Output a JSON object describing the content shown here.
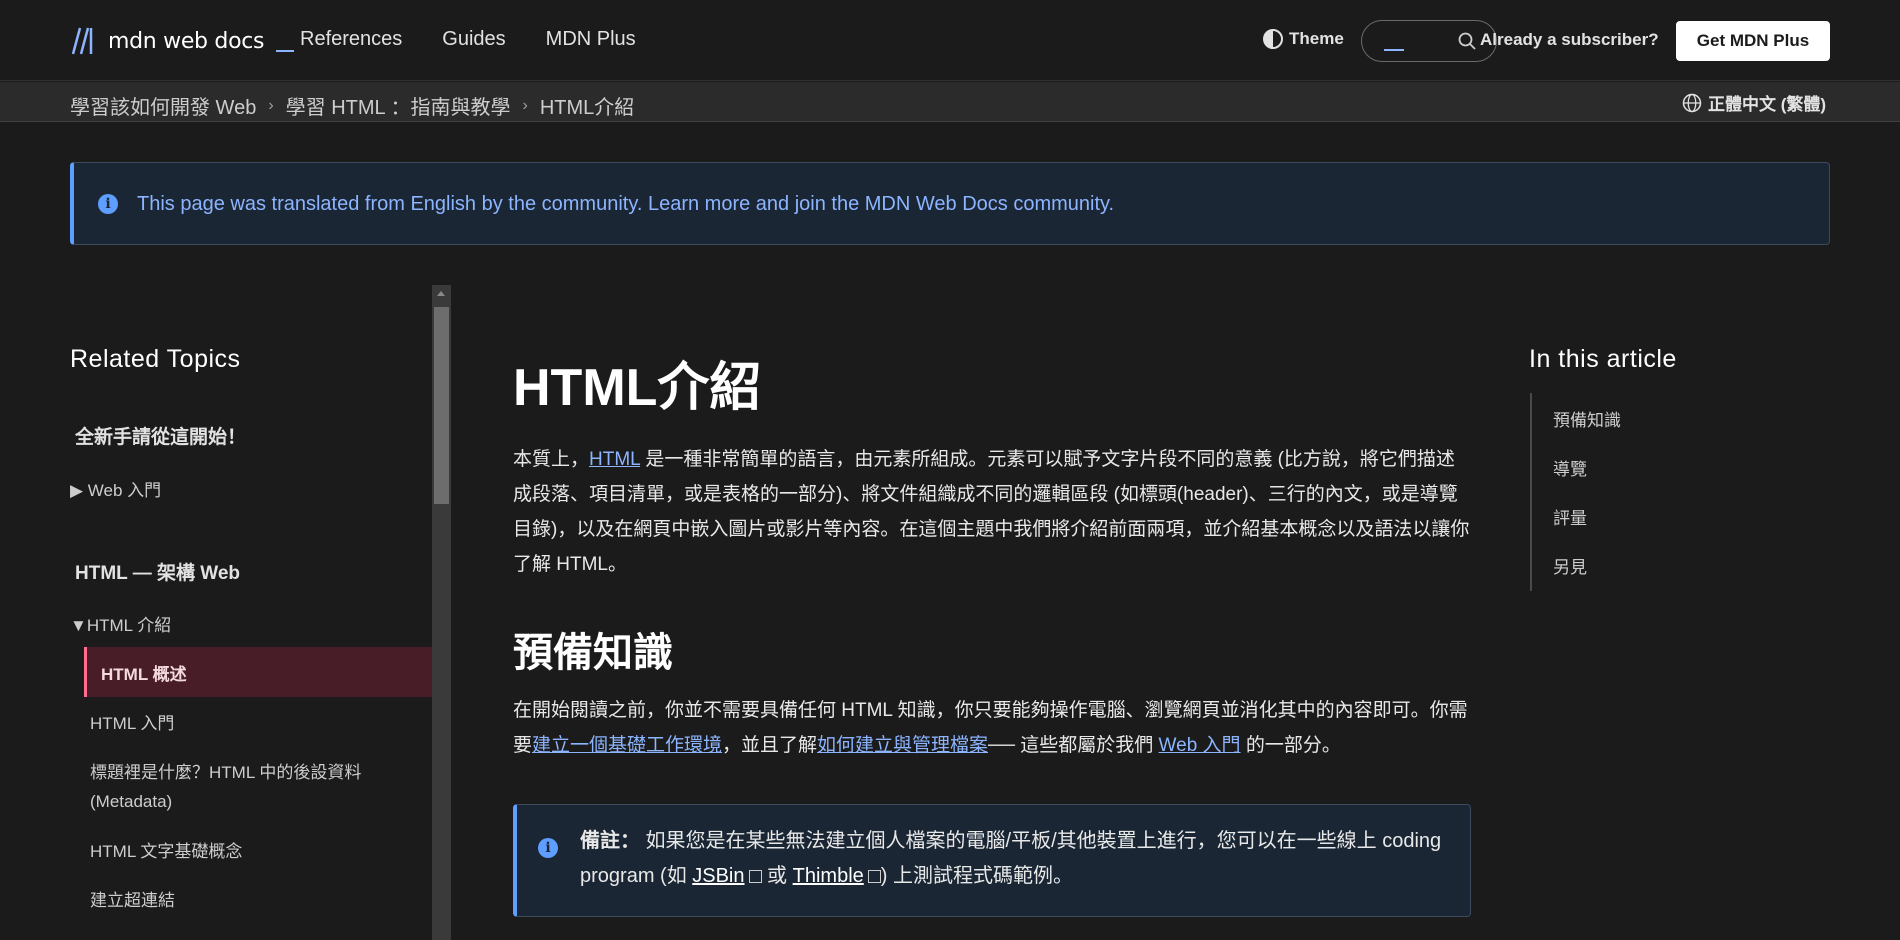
{
  "header": {
    "logo_text": "mdn web docs",
    "nav": [
      "References",
      "Guides",
      "MDN Plus"
    ],
    "theme_label": "Theme",
    "subscriber_text": "Already a subscriber?",
    "get_plus_label": "Get MDN Plus"
  },
  "breadcrumb": {
    "items": [
      "學習該如何開發 Web",
      "學習 HTML ：指南與教學",
      "HTML介紹"
    ],
    "language": "正體中文 (繁體)"
  },
  "notice": {
    "text": "This page was translated from English by the community. Learn more and join the MDN Web Docs community."
  },
  "sidebar": {
    "title": "Related Topics",
    "section1_heading": "全新手請從這開始！",
    "section1_toggle": "▶ Web 入門",
    "section2_heading": "HTML — 架構 Web",
    "section2_toggle": "▼HTML 介紹",
    "active_item": "HTML 概述",
    "items": [
      "HTML 入門",
      "標題裡是什麼？HTML 中的後設資料 (Metadata)",
      "HTML 文字基礎概念",
      "建立超連結"
    ]
  },
  "main": {
    "title": "HTML介紹",
    "intro_pre": "本質上，",
    "intro_link": "HTML",
    "intro_post": " 是一種非常簡單的語言，由元素所組成。元素可以賦予文字片段不同的意義 (比方說，將它們描述成段落、項目清單，或是表格的一部分)、將文件組織成不同的邏輯區段 (如標頭(header)、三行的內文，或是導覽目錄)，以及在網頁中嵌入圖片或影片等內容。在這個主題中我們將介紹前面兩項，並介紹基本概念以及語法以讓你了解 HTML。",
    "section_heading": "預備知識",
    "pre_text1": "在開始閱讀之前，你並不需要具備任何 HTML 知識，你只要能夠操作電腦、瀏覽網頁並消化其中的內容即可。你需要",
    "pre_link1": "建立一個基礎工作環境",
    "pre_text2": "，並且了解",
    "pre_link2": "如何建立與管理檔案",
    "pre_text3": "── 這些都屬於我們 ",
    "pre_link3": "Web 入門",
    "pre_text4": " 的一部分。",
    "note_label": "備註：",
    "note_text1": " 如果您是在某些無法建立個人檔案的電腦/平板/其他裝置上進行，您可以在一些線上 coding program (如 ",
    "note_link1": "JSBin",
    "note_text2": " 或 ",
    "note_link2": "Thimble",
    "note_text3": ") 上測試程式碼範例。"
  },
  "toc": {
    "title": "In this article",
    "items": [
      "預備知識",
      "導覽",
      "評量",
      "另見"
    ]
  },
  "colors": {
    "background": "#1b1b1b",
    "link": "#8cb4ff",
    "accent_active": "#ff6d91",
    "info": "#5e9eff"
  }
}
